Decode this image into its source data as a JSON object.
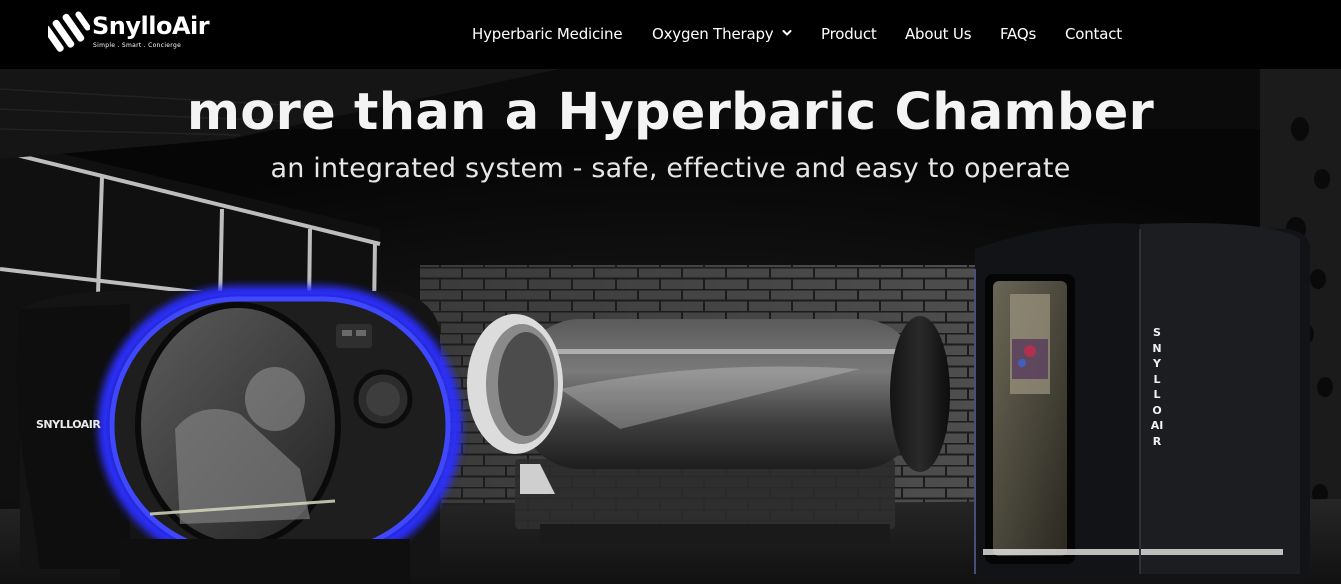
{
  "header": {
    "logo": {
      "name": "SnylloAir",
      "tagline": "Simple . Smart . Concierge"
    },
    "nav": [
      {
        "label": "Hyperbaric Medicine"
      },
      {
        "label": "Oxygen Therapy",
        "has_dropdown": true,
        "icon": "chevron-down-icon"
      },
      {
        "label": "Product"
      },
      {
        "label": "About Us"
      },
      {
        "label": "FAQs"
      },
      {
        "label": "Contact"
      }
    ]
  },
  "hero": {
    "title": "more than a Hyperbaric Chamber",
    "subtitle": "an integrated system - safe, effective and easy to operate",
    "chamber_brand": "SNYLLOAIR",
    "vertical_brand": "SNYLLO AIR"
  },
  "colors": {
    "header_bg": "#000000",
    "accent_glow": "#2a2dff",
    "text": "#ffffff"
  }
}
